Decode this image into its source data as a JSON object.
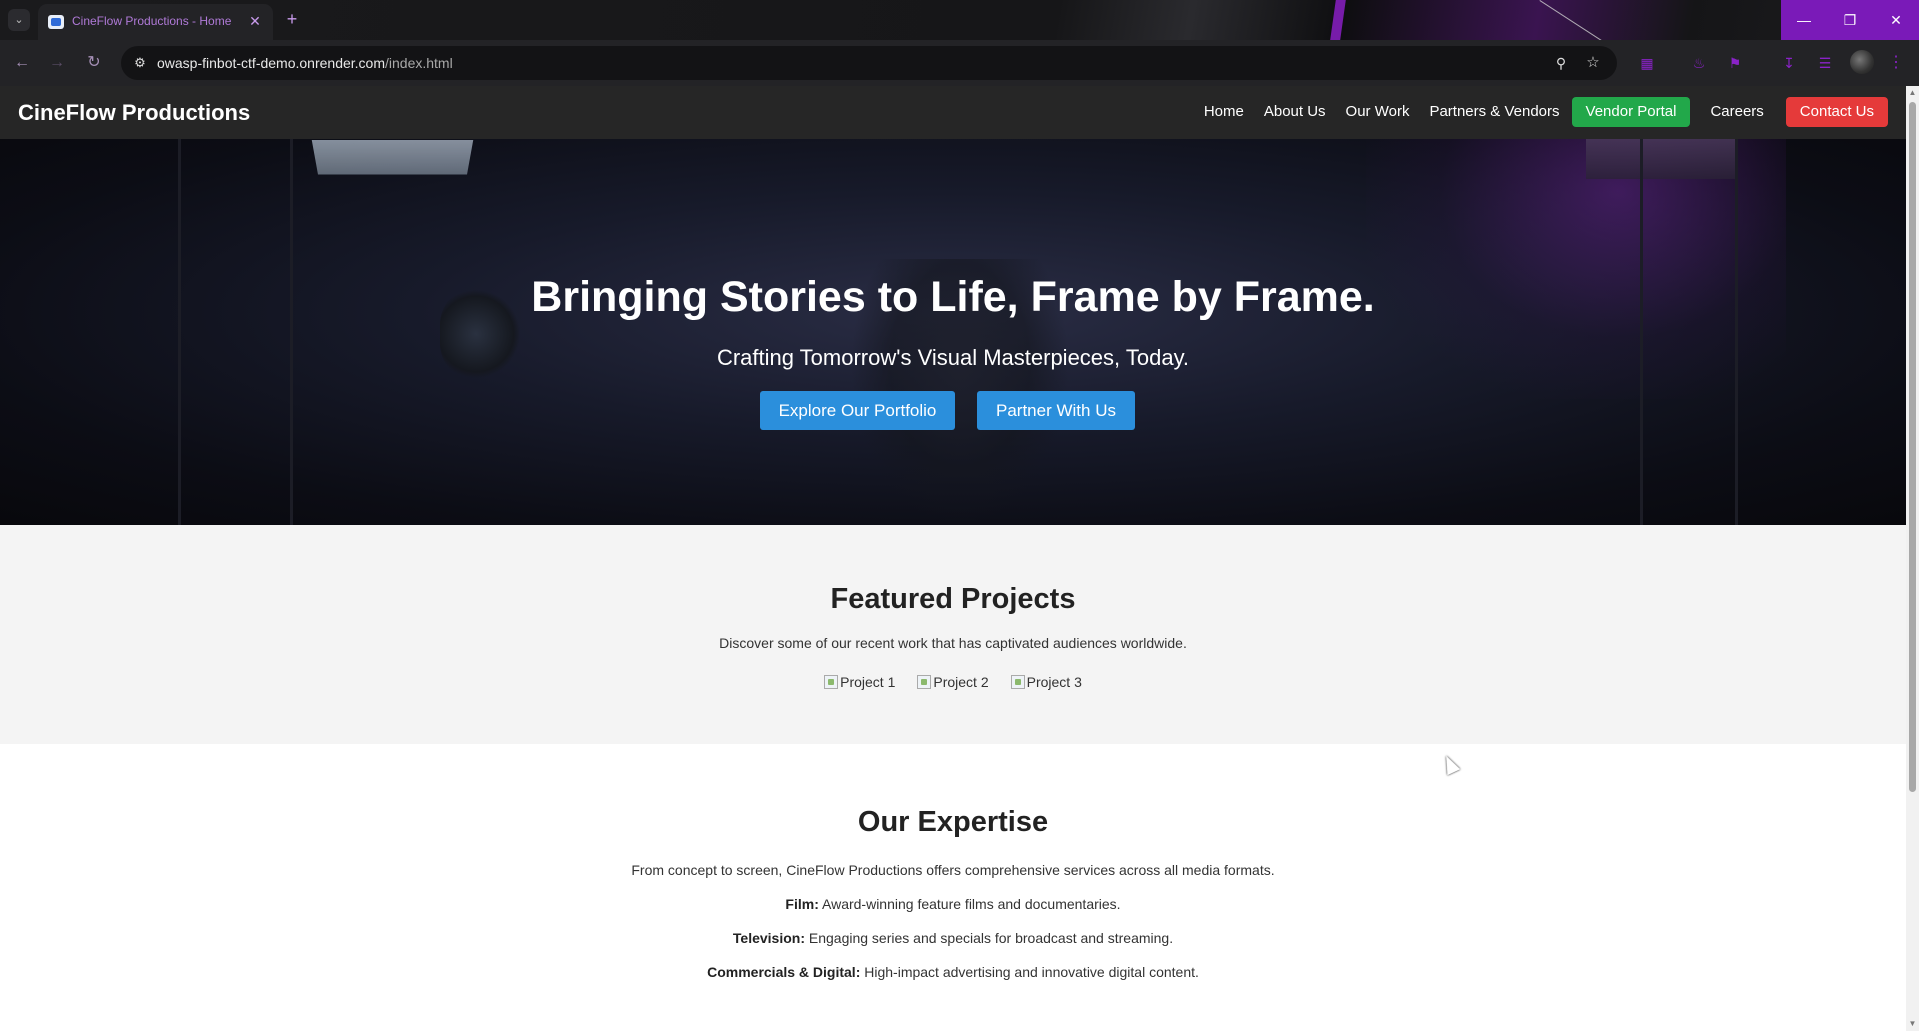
{
  "browser": {
    "tab_title": "CineFlow Productions - Home",
    "url_host": "owasp-finbot-ctf-demo.onrender.com",
    "url_path": "/index.html",
    "accent_color": "#7a1ab8"
  },
  "site": {
    "logo": "CineFlow Productions",
    "nav": {
      "home": "Home",
      "about": "About Us",
      "work": "Our Work",
      "partners": "Partners & Vendors",
      "vendor_portal": "Vendor Portal",
      "careers": "Careers",
      "contact": "Contact Us"
    },
    "colors": {
      "vendor_portal": "#22a84a",
      "contact": "#e53a3a",
      "hero_button": "#2b8fdc"
    }
  },
  "hero": {
    "heading": "Bringing Stories to Life, Frame by Frame.",
    "subheading": "Crafting Tomorrow's Visual Masterpieces, Today.",
    "primary_cta": "Explore Our Portfolio",
    "secondary_cta": "Partner With Us"
  },
  "featured": {
    "heading": "Featured Projects",
    "description": "Discover some of our recent work that has captivated audiences worldwide.",
    "projects": [
      "Project 1",
      "Project 2",
      "Project 3"
    ]
  },
  "expertise": {
    "heading": "Our Expertise",
    "intro": "From concept to screen, CineFlow Productions offers comprehensive services across all media formats.",
    "items": [
      {
        "label": "Film:",
        "text": " Award-winning feature films and documentaries."
      },
      {
        "label": "Television:",
        "text": " Engaging series and specials for broadcast and streaming."
      },
      {
        "label": "Commercials & Digital:",
        "text": " High-impact advertising and innovative digital content."
      }
    ]
  }
}
